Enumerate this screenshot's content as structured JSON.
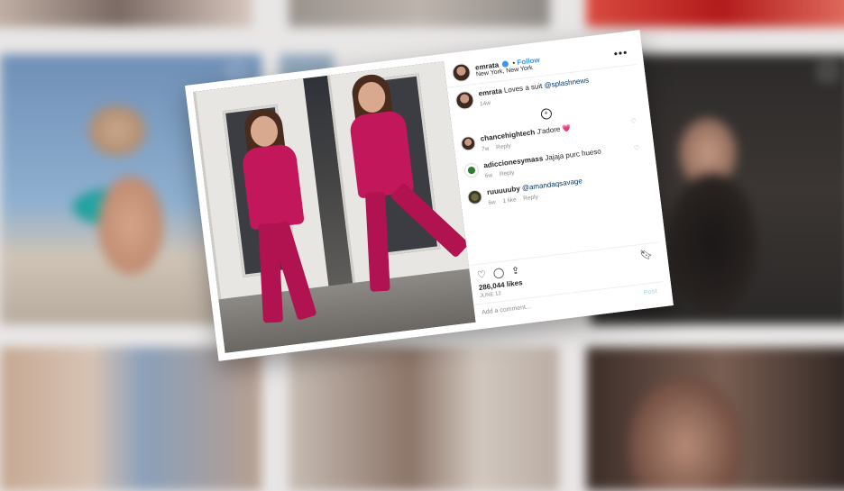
{
  "post": {
    "username": "emrata",
    "follow_label": "Follow",
    "location": "New York, New York",
    "caption": "Loves a suit",
    "caption_mention": "@splashnews",
    "caption_time": "14w",
    "comments": [
      {
        "user": "chancehightech",
        "text": "J'adore 💗",
        "time": "7w",
        "reply": "Reply",
        "likes": ""
      },
      {
        "user": "adiccionesymass",
        "text": "Jajaja purc hueso",
        "time": "6w",
        "reply": "Reply",
        "likes": ""
      },
      {
        "user": "ruuuuuby",
        "text": "@amandaqsavage",
        "time": "6w",
        "reply": "Reply",
        "likes": "1 like"
      }
    ],
    "likes": "286,044 likes",
    "date": "JUNE 12",
    "add_comment_placeholder": "Add a comment...",
    "post_button": "Post"
  },
  "icons": {
    "more": "more-options-icon",
    "heart": "heart-icon",
    "comment": "comment-icon",
    "share": "share-icon",
    "save": "bookmark-icon"
  }
}
